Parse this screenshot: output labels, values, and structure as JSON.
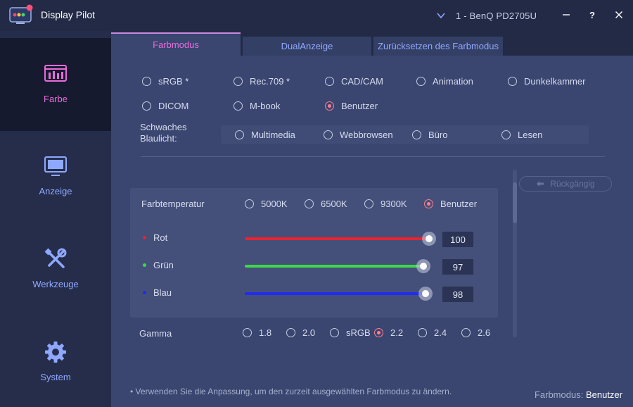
{
  "app": {
    "title": "Display Pilot"
  },
  "monitor": {
    "name": "1 - BenQ PD2705U"
  },
  "window_controls": {
    "minimize": "—",
    "help": "?",
    "close": "✕"
  },
  "sidebar": {
    "items": [
      {
        "label": "Farbe",
        "icon": "color-palette-icon",
        "active": true
      },
      {
        "label": "Anzeige",
        "icon": "monitor-icon",
        "active": false
      },
      {
        "label": "Werkzeuge",
        "icon": "tools-icon",
        "active": false
      },
      {
        "label": "System",
        "icon": "gear-icon",
        "active": false
      }
    ]
  },
  "tabs": [
    {
      "label": "Farbmodus",
      "active": true
    },
    {
      "label": "DualAnzeige",
      "active": false
    },
    {
      "label": "Zurücksetzen des Farbmodus",
      "active": false
    }
  ],
  "color_modes": {
    "options": [
      "sRGB *",
      "Rec.709 *",
      "CAD/CAM",
      "Animation",
      "Dunkelkammer",
      "DICOM",
      "M-book",
      "Benutzer"
    ],
    "selected": "Benutzer"
  },
  "low_blue_light": {
    "label_line1": "Schwaches",
    "label_line2": "Blaulicht:",
    "options": [
      "Multimedia",
      "Webbrowsen",
      "Büro",
      "Lesen"
    ],
    "selected": null
  },
  "undo": {
    "label": "Rückgängig",
    "enabled": false
  },
  "color_temperature": {
    "label": "Farbtemperatur",
    "options": [
      "5000K",
      "6500K",
      "9300K",
      "Benutzer"
    ],
    "selected": "Benutzer"
  },
  "channels": [
    {
      "label": "Rot",
      "value": 100,
      "display": "100",
      "color": "#e8232f"
    },
    {
      "label": "Grün",
      "value": 97,
      "display": "97",
      "color": "#3ed84a"
    },
    {
      "label": "Blau",
      "value": 98,
      "display": "98",
      "color": "#1f2cf0"
    }
  ],
  "slider_max": 100,
  "gamma": {
    "label": "Gamma",
    "options": [
      "1.8",
      "2.0",
      "sRGB",
      "2.2",
      "2.4",
      "2.6"
    ],
    "selected": "2.2"
  },
  "footer": {
    "note": "• Verwenden Sie die Anpassung, um den zurzeit ausgewählten Farbmodus zu ändern.",
    "status_label": "Farbmodus:",
    "status_value": "Benutzer"
  },
  "colors": {
    "accent_pink": "#e86bd9",
    "accent_blue": "#8fa8ff",
    "radio_selected": "#ff7d8d"
  }
}
